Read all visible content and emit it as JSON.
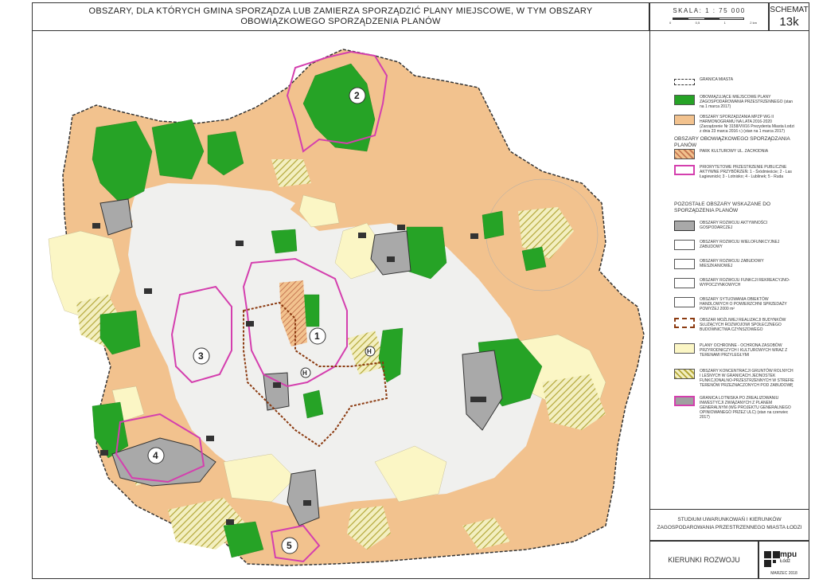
{
  "header": {
    "title": "OBSZARY, DLA KTÓRYCH GMINA SPORZĄDZA LUB ZAMIERZA SPORZĄDZIĆ PLANY MIEJSCOWE, W TYM OBSZARY OBOWIĄZKOWEGO SPORZĄDZENIA PLANÓW",
    "scale_label": "SKALA: 1 : 75 000",
    "scale_ticks": [
      "0",
      "0,5",
      "1",
      "2 km"
    ],
    "schemat_label": "SCHEMAT",
    "schemat_number": "13k"
  },
  "legend": {
    "items": [
      {
        "label": "GRANICA MIASTA"
      },
      {
        "label": "OBOWIĄZUJĄCE MIEJSCOWE PLANY ZAGOSPODAROWANIA PRZESTRZENNEGO (stan na 1 marca 2017)"
      },
      {
        "label": "OBSZARY SPORZĄDZANIA MPZP WG II HARMONOGRAMU NA LATA 2016-2020 (Zarządzenie Nr 3158/VII/16 Prezydenta Miasta Łodzi z dnia 23 marca 2016 r.) (stan na 1 marca 2017)"
      }
    ],
    "section1_title": "OBSZARY OBOWIĄZKOWEGO SPORZĄDZANIA PLANÓW",
    "section1_items": [
      {
        "label": "PARK KULTUROWY UL. ZACHODNIA"
      },
      {
        "label": "PRIORYTETOWE PRZESTRZENIE PUBLICZNE AKTYWNE PRZYBÓRZEŃ: 1 - Śródmieście; 2 - Las Łagiewnicki; 3 - Lotnisko; 4 - Lublinek; 5 - Ruda"
      }
    ],
    "section2_title": "POZOSTAŁE OBSZARY WSKAZANE DO SPORZĄDZENIA PLANÓW",
    "section2_items": [
      {
        "label": "OBSZARY ROZWOJU AKTYWNOŚCI GOSPODARCZEJ"
      },
      {
        "label": "OBSZARY ROZWOJU WIELOFUNKCYJNEJ ZABUDOWY"
      },
      {
        "label": "OBSZARY ROZWOJU ZABUDOWY MIESZKANIOWEJ"
      },
      {
        "label": "OBSZARY ROZWOJU FUNKCJI REKREACYJNO-WYPOCZYNKOWYCH"
      },
      {
        "label": "OBSZARY SYTUOWANIA OBIEKTÓW HANDLOWYCH O POWIERZCHNI SPRZEDAŻY POWYŻEJ 2000 m²"
      },
      {
        "label": "OBSZAR MOŻLIWEJ REALIZACJI BUDYNKÓW SŁUŻĄCYCH ROZWOJOWI SPOŁECZNEGO BUDOWNICTWA CZYNSZOWEGO"
      },
      {
        "label": "PLANY OCHRONNE - OCHRONA ZASOBÓW PRZYRODNICZYCH I KULTUROWYCH WRAZ Z TERENAMI PRZYLEGŁYMI"
      },
      {
        "label": "OBSZARY KONCENTRACJI GRUNTÓW ROLNYCH I LEŚNYCH W GRANICACH JEDNOSTEK FUNKCJONALNO-PRZESTRZENNYCH W STREFIE TERENÓW PRZEZNACZONYCH POD ZABUDOWĘ"
      },
      {
        "label": "GRANICA LOTNISKA PO ZREALIZOWANIU INWESTYCJI ZWIĄZANYCH Z PLANEM GENERALNYM (WG PROJEKTU GENERALNEGO OPINIOWANEGO PRZEZ ULC) (stan na czerwiec 2017)"
      }
    ],
    "colors": {
      "existing_plans": "#26a326",
      "plans_in_progress": "#f2c28e",
      "protective_plans": "#fbf6c5",
      "airport": "#a0a0a0",
      "priority": "#d43fae",
      "social_housing": "#8b3a10"
    }
  },
  "map": {
    "zone_labels": [
      "1",
      "2",
      "3",
      "4",
      "5"
    ],
    "trade_marker": "H"
  },
  "footer": {
    "study_title": "STUDIUM UWARUNKOWAŃ I KIERUNKÓW ZAGOSPODAROWANIA PRZESTRZENNEGO MIASTA ŁODZI",
    "section_title": "KIERUNKI ROZWOJU",
    "logo_text": "mpu",
    "logo_sub": "Łódź",
    "date": "MARZEC 2018"
  }
}
